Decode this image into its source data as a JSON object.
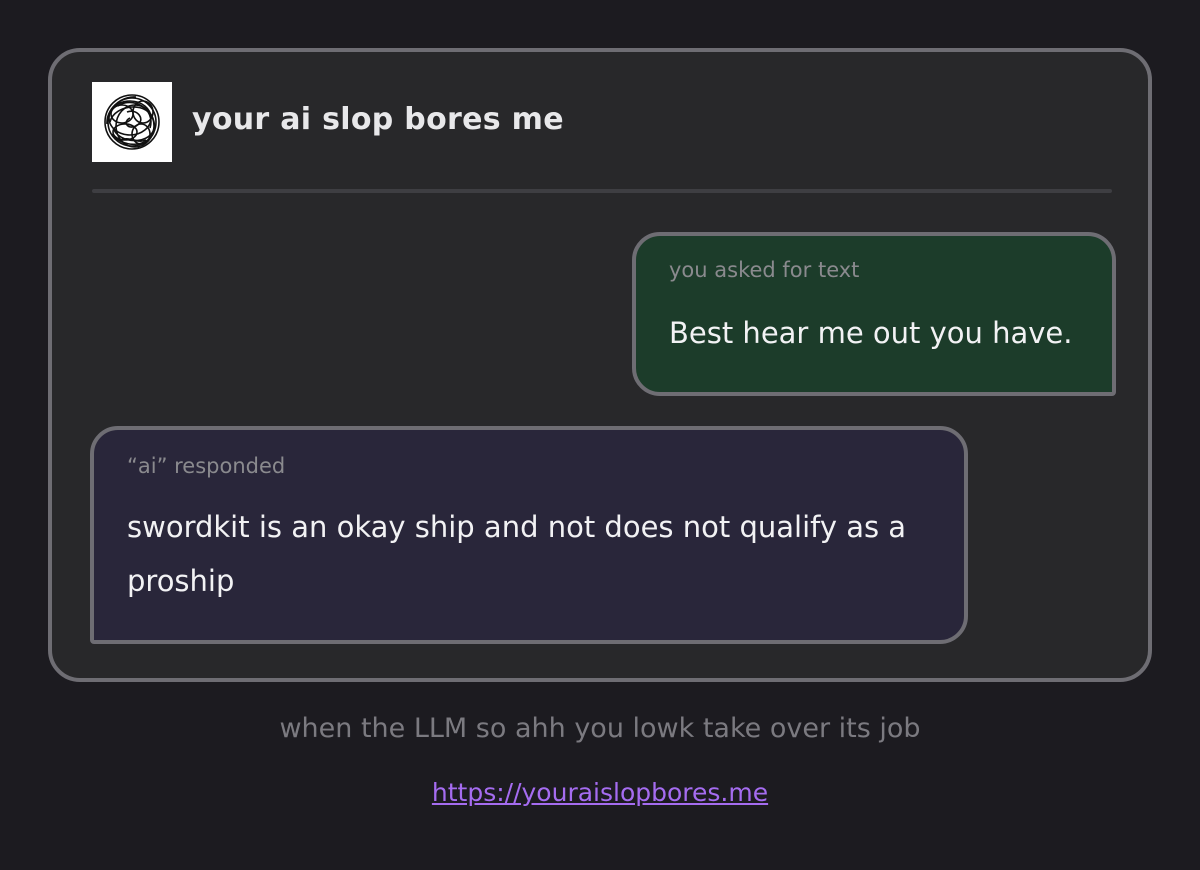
{
  "header": {
    "title": "your ai slop bores me",
    "avatar_icon": "scribble-logo-icon"
  },
  "messages": [
    {
      "role": "user",
      "label": "you asked for text",
      "text": "Best hear me out you have."
    },
    {
      "role": "ai",
      "label": "“ai” responded",
      "text": "swordkit is an okay ship and not does not qualify as a proship"
    }
  ],
  "footer": {
    "caption": "when the LLM so ahh you lowk take over its job",
    "link": "https://youraislopbores.me"
  },
  "colors": {
    "page_background": "#1c1b20",
    "card_background": "#28282a",
    "border": "#6e6d73",
    "user_bubble": "#1c3c2a",
    "ai_bubble": "#29263a",
    "link": "#a56cf0"
  }
}
